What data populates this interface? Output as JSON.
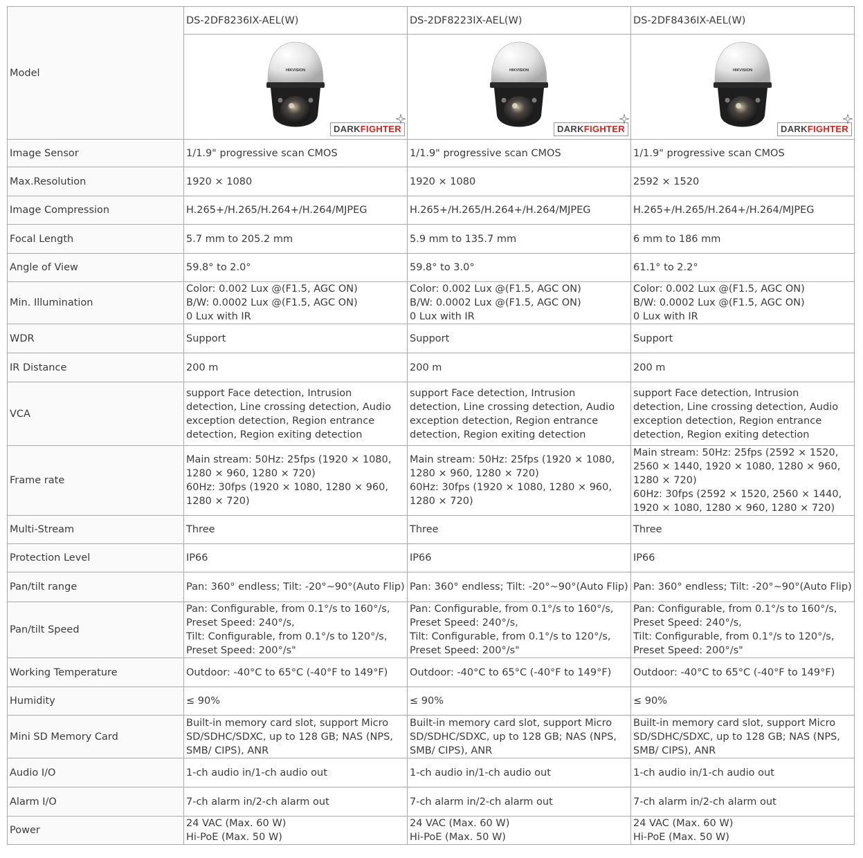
{
  "model_label": "Model",
  "models": [
    {
      "name": "DS-2DF8236IX-AEL(W)"
    },
    {
      "name": "DS-2DF8223IX-AEL(W)"
    },
    {
      "name": "DS-2DF8436IX-AEL(W)"
    }
  ],
  "badge": {
    "part1": "DARK",
    "part2": "FIGHTER"
  },
  "colors": {
    "border": "#a9a9a9",
    "badge_red": "#d9231d",
    "text": "#3a3a3a"
  },
  "rows": [
    {
      "label": "Image Sensor",
      "cells": [
        [
          "1/1.9\" progressive scan CMOS"
        ],
        [
          "1/1.9\" progressive scan CMOS"
        ],
        [
          "1/1.9\" progressive scan CMOS"
        ]
      ]
    },
    {
      "label": "Max.Resolution",
      "cells": [
        [
          "1920 × 1080"
        ],
        [
          "1920 × 1080"
        ],
        [
          "2592 × 1520"
        ]
      ]
    },
    {
      "label": "Image Compression",
      "cells": [
        [
          "H.265+/H.265/H.264+/H.264/MJPEG"
        ],
        [
          "H.265+/H.265/H.264+/H.264/MJPEG"
        ],
        [
          "H.265+/H.265/H.264+/H.264/MJPEG"
        ]
      ]
    },
    {
      "label": "Focal Length",
      "cells": [
        [
          "5.7 mm to 205.2 mm"
        ],
        [
          "5.9 mm to 135.7 mm"
        ],
        [
          "6 mm to 186 mm"
        ]
      ]
    },
    {
      "label": "Angle of View",
      "cells": [
        [
          "59.8° to 2.0°"
        ],
        [
          "59.8° to 3.0°"
        ],
        [
          "61.1° to 2.2°"
        ]
      ]
    },
    {
      "label": "Min. Illumination",
      "cells": [
        [
          "Color:  0.002 Lux @(F1.5, AGC ON)",
          "B/W:  0.0002 Lux @(F1.5, AGC ON)",
          "0 Lux with IR"
        ],
        [
          "Color:  0.002 Lux @(F1.5, AGC ON)",
          "B/W:  0.0002 Lux @(F1.5, AGC ON)",
          "0 Lux with IR"
        ],
        [
          "Color:  0.002 Lux @(F1.5, AGC ON)",
          "B/W:  0.0002 Lux @(F1.5, AGC ON)",
          "0 Lux with IR"
        ]
      ]
    },
    {
      "label": "WDR",
      "cells": [
        [
          "Support"
        ],
        [
          "Support"
        ],
        [
          "Support"
        ]
      ]
    },
    {
      "label": "IR Distance",
      "cells": [
        [
          "200 m"
        ],
        [
          "200 m"
        ],
        [
          "200 m"
        ]
      ]
    },
    {
      "label": "VCA",
      "cells": [
        [
          "support Face detection, Intrusion detection, Line crossing detection, Audio exception detection, Region entrance detection, Region exiting detection"
        ],
        [
          "support Face detection, Intrusion detection, Line crossing detection, Audio exception detection, Region entrance detection, Region exiting detection"
        ],
        [
          "support Face detection, Intrusion detection, Line crossing detection, Audio exception detection, Region entrance detection, Region exiting detection"
        ]
      ]
    },
    {
      "label": "Frame rate",
      "cells": [
        [
          "Main stream:  50Hz:  25fps (1920 × 1080, 1280 × 960, 1280 × 720)",
          "60Hz:  30fps (1920 × 1080, 1280 × 960, 1280 × 720)"
        ],
        [
          "Main stream:  50Hz:  25fps (1920 × 1080, 1280 × 960, 1280 × 720)",
          "60Hz:  30fps (1920 × 1080, 1280 × 960, 1280 × 720)"
        ],
        [
          "Main stream: 50Hz:  25fps (2592 × 1520, 2560 × 1440, 1920 × 1080, 1280 × 960, 1280 × 720)",
          "60Hz:  30fps (2592 × 1520, 2560 × 1440, 1920 × 1080, 1280 × 960, 1280 × 720)"
        ]
      ]
    },
    {
      "label": "Multi-Stream",
      "cells": [
        [
          "Three"
        ],
        [
          "Three"
        ],
        [
          "Three"
        ]
      ]
    },
    {
      "label": "Protection Level",
      "cells": [
        [
          "IP66"
        ],
        [
          "IP66"
        ],
        [
          "IP66"
        ]
      ]
    },
    {
      "label": "Pan/tilt range",
      "cells": [
        [
          "Pan: 360° endless; Tilt:  -20°~90°(Auto Flip)"
        ],
        [
          "Pan: 360° endless; Tilt:  -20°~90°(Auto Flip)"
        ],
        [
          "Pan: 360° endless; Tilt:  -20°~90°(Auto Flip)"
        ]
      ]
    },
    {
      "label": "Pan/tilt Speed",
      "cells": [
        [
          "Pan: Configurable, from 0.1°/s to 160°/s,",
          "Preset Speed:  240°/s,",
          "Tilt: Configurable, from 0.1°/s to 120°/s,",
          "Preset Speed:  200°/s\""
        ],
        [
          "Pan: Configurable, from 0.1°/s to 160°/s,",
          "Preset Speed:  240°/s,",
          "Tilt: Configurable, from 0.1°/s to 120°/s,",
          "Preset Speed:  200°/s\""
        ],
        [
          "Pan: Configurable, from 0.1°/s to 160°/s,",
          "Preset Speed:  240°/s,",
          "Tilt: Configurable, from 0.1°/s to 120°/s,",
          "Preset Speed:  200°/s\""
        ]
      ]
    },
    {
      "label": "Working Temperature",
      "cells": [
        [
          "Outdoor:  -40°C to 65°C (-40°F to 149°F)"
        ],
        [
          "Outdoor:  -40°C to 65°C (-40°F to 149°F)"
        ],
        [
          "Outdoor:  -40°C to 65°C (-40°F to 149°F)"
        ]
      ]
    },
    {
      "label": "Humidity",
      "cells": [
        [
          "≤ 90%"
        ],
        [
          "≤ 90%"
        ],
        [
          "≤ 90%"
        ]
      ]
    },
    {
      "label": "Mini SD Memory Card",
      "cells": [
        [
          "Built-in memory card slot, support Micro SD/SDHC/SDXC, up to 128 GB; NAS (NPS, SMB/ CIPS), ANR"
        ],
        [
          "Built-in memory card slot, support Micro SD/SDHC/SDXC, up to 128 GB; NAS (NPS, SMB/ CIPS), ANR"
        ],
        [
          "Built-in memory card slot, support Micro SD/SDHC/SDXC, up to 128 GB; NAS (NPS, SMB/ CIPS), ANR"
        ]
      ]
    },
    {
      "label": "Audio I/O",
      "cells": [
        [
          "1-ch audio in/1-ch audio out"
        ],
        [
          "1-ch audio in/1-ch audio out"
        ],
        [
          "1-ch audio in/1-ch audio out"
        ]
      ]
    },
    {
      "label": "Alarm I/O",
      "cells": [
        [
          "7-ch alarm in/2-ch alarm out"
        ],
        [
          "7-ch alarm in/2-ch alarm out"
        ],
        [
          "7-ch alarm in/2-ch alarm out"
        ]
      ]
    },
    {
      "label": "Power",
      "cells": [
        [
          "24 VAC (Max. 60 W)",
          "Hi-PoE (Max. 50 W)"
        ],
        [
          "24 VAC (Max. 60 W)",
          "Hi-PoE (Max. 50 W)"
        ],
        [
          "24 VAC (Max. 60 W)",
          "Hi-PoE (Max. 50 W)"
        ]
      ]
    }
  ]
}
